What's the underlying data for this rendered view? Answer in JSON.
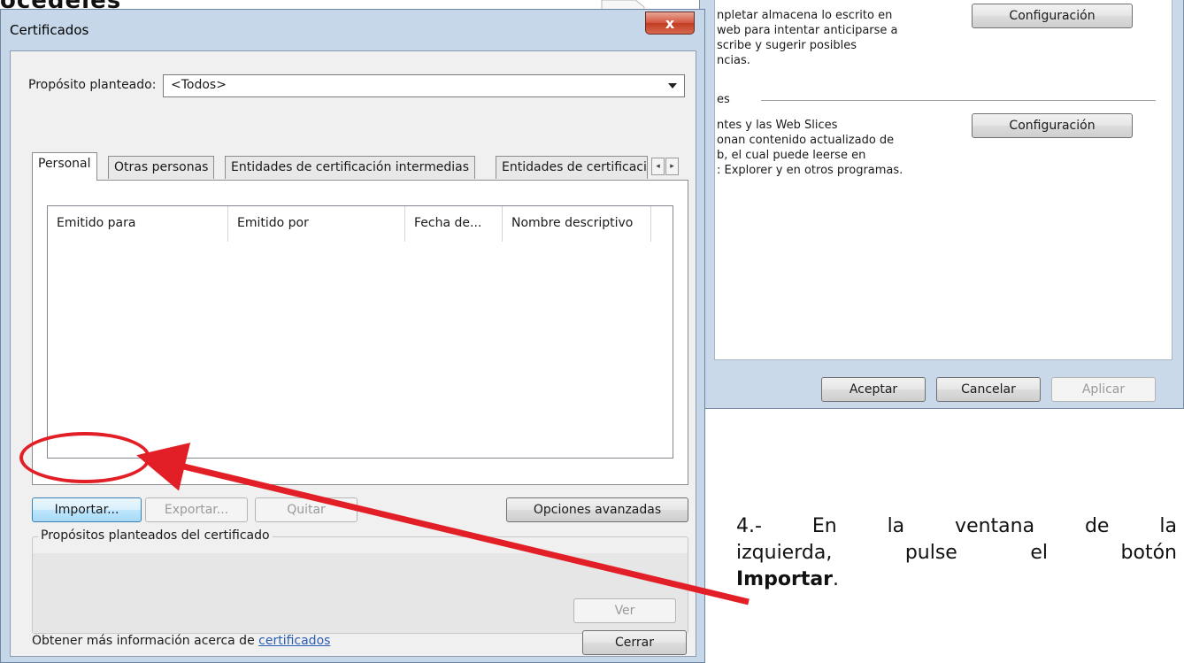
{
  "top_artifact": "ocedeles",
  "background_dialog": {
    "section1_text": "npletar almacena lo escrito en\nweb para intentar anticiparse a\nscribe y sugerir posibles\nncias.",
    "section2_heading": "es",
    "section2_text": "ntes y las Web Slices\nonan contenido actualizado de\nb, el cual puede leerse en\n: Explorer y en otros programas.",
    "config_button_1": "Configuración",
    "config_button_2": "Configuración",
    "accept_button": "Aceptar",
    "cancel_button": "Cancelar",
    "apply_button": "Aplicar"
  },
  "certificates_dialog": {
    "title": "Certificados",
    "close_symbol": "x",
    "purpose_label": "Propósito planteado:",
    "purpose_value": "<Todos>",
    "tabs": [
      {
        "label": "Personal",
        "active": true
      },
      {
        "label": "Otras personas",
        "active": false
      },
      {
        "label": "Entidades de certificación intermedias",
        "active": false
      },
      {
        "label": "Entidades de certificaci",
        "active": false
      }
    ],
    "tab_scroll_left": "◂",
    "tab_scroll_right": "▸",
    "columns": [
      "Emitido para",
      "Emitido por",
      "Fecha de...",
      "Nombre descriptivo"
    ],
    "rows": [],
    "buttons": {
      "import": "Importar...",
      "export": "Exportar...",
      "remove": "Quitar",
      "advanced": "Opciones avanzadas",
      "view": "Ver",
      "close": "Cerrar"
    },
    "purposes_group_label": "Propósitos planteados del certificado",
    "more_info_text": "Obtener más información acerca de ",
    "more_info_link": "certificados"
  },
  "instruction": {
    "prefix": "4.-",
    "line1_words": [
      "En",
      "la",
      "ventana",
      "de",
      "la"
    ],
    "line2_words": [
      "izquierda,",
      "pulse",
      "el",
      "botón"
    ],
    "bold_word": "Importar",
    "suffix": "."
  },
  "colors": {
    "annotation_red": "#e21f26",
    "dialog_frame": "#c6d7ea",
    "link": "#2a5db0"
  }
}
